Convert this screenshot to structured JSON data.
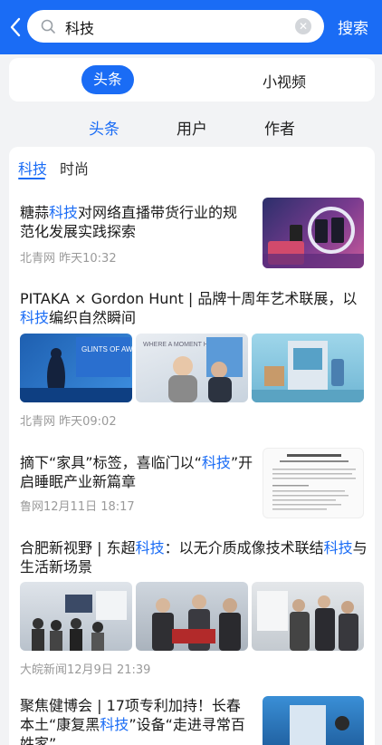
{
  "search": {
    "query": "科技",
    "button_label": "搜索"
  },
  "segment": {
    "active": "头条",
    "other": "小视频"
  },
  "subtabs": [
    "头条",
    "用户",
    "作者"
  ],
  "category_tabs": [
    "科技",
    "时尚"
  ],
  "articles": [
    {
      "title_parts": [
        "糖蒜",
        "科技",
        "对网络直播带货行业的规范化发展实践探索"
      ],
      "source_time": "北青网 昨天10:32"
    },
    {
      "title_parts": [
        "PITAKA × Gordon Hunt | 品牌十周年艺术联展，以",
        "科技",
        "编织自然瞬间"
      ],
      "source_time": "北青网 昨天09:02",
      "image_texts": [
        "GLINTS OF AWARENESS",
        "WHERE A MOMENT HOLDS"
      ]
    },
    {
      "title_parts": [
        "摘下“家具”标签，喜临门以“",
        "科技",
        "”开启睡眠产业新篇章"
      ],
      "source_time": "鲁网12月11日 18:17"
    },
    {
      "title_parts": [
        "合肥新视野 | 东超",
        "科技",
        "：以无介质成像技术联结",
        "科技",
        "与生活新场景"
      ],
      "source_time": "大皖新闻12月9日 21:39"
    },
    {
      "title_parts": [
        "聚焦健博会 | 17项专利加持！长春本土“康复黑",
        "科技",
        "”设备“走进寻常百姓家”"
      ]
    }
  ],
  "colors": {
    "accent": "#1a6cf5",
    "meta": "#9a9a9a"
  }
}
